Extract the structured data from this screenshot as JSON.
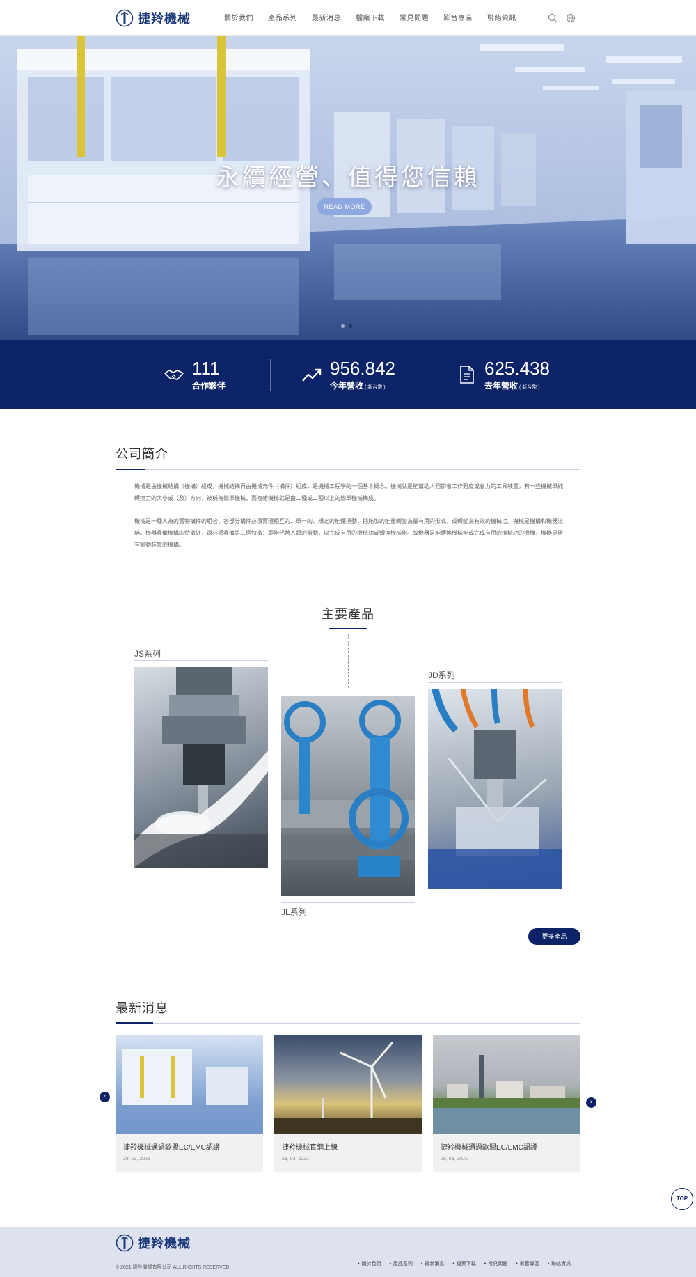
{
  "header": {
    "logo_text": "捷羚機械",
    "nav": [
      "關於我們",
      "產品系列",
      "最新消息",
      "檔案下載",
      "常見問題",
      "影音專區",
      "聯絡資訊"
    ],
    "search_icon": "search-icon",
    "language_icon": "globe-icon"
  },
  "hero": {
    "title": "永續經營、值得您信賴",
    "button": "READ MORE",
    "slide_count": 2,
    "active_slide": 2
  },
  "stats": [
    {
      "icon": "handshake-icon",
      "value": "111",
      "label": "合作夥伴",
      "unit": ""
    },
    {
      "icon": "trend-up-icon",
      "value": "956.842",
      "label": "今年營收",
      "unit": "( 新台幣 )"
    },
    {
      "icon": "document-icon",
      "value": "625.438",
      "label": "去年營收",
      "unit": "( 新台幣 )"
    }
  ],
  "about": {
    "title": "公司簡介",
    "paragraphs": [
      "機械是由機械結構（機構）組成，機械結構再由機械元件（構件）組成，是機械工程學的一個基本概念。機械就是能幫助人們節省工作難度或省力的工具裝置，有一些機械單純轉換力的大小或（及）方向，被稱為簡單機械，而複雜機械就是由二種或二種以上的簡單機械構成。",
      "機械是一種人為的實物構件的組合，各部分構件必須實現相互的、單一的、規定的能體運動，把施加的能量轉變為最有用的形式，或轉變為有效的機械功。機械是機構和機器泛稱。機器具備機構的特徵外，還必須具備第三個特徵：即能代替人類的勞動，以完成有用的機械功或轉換機械能。故機器是能轉換機械能或完成有用的機械功的機構，機器是帶有驅動裝置的機構。"
    ]
  },
  "products": {
    "title": "主要產品",
    "items": [
      {
        "label": "JS系列"
      },
      {
        "label": "JL系列"
      },
      {
        "label": "JD系列"
      }
    ],
    "more_button": "更多產品"
  },
  "news": {
    "title": "最新消息",
    "items": [
      {
        "title": "捷羚機械通過歐盟EC/EMC認證",
        "date": "28, 03, 2021"
      },
      {
        "title": "捷羚機械官網上線",
        "date": "28, 03, 2021"
      },
      {
        "title": "捷羚機械通過歐盟EC/EMC認證",
        "date": "28, 03, 2021"
      }
    ],
    "prev": "‹",
    "next": "›"
  },
  "top_button": "TOP",
  "footer": {
    "logo_text": "捷羚機械",
    "copyright": "© 2021 捷羚機械有限公司 ALL RIGHTS RESERVED",
    "links": [
      "關於我們",
      "產品系列",
      "最新消息",
      "檔案下載",
      "常見問題",
      "影音專區",
      "聯絡資訊"
    ]
  },
  "colors": {
    "brand_navy": "#0c2467",
    "accent_light": "#8fa8e0",
    "footer_bg": "#dde2ee"
  }
}
